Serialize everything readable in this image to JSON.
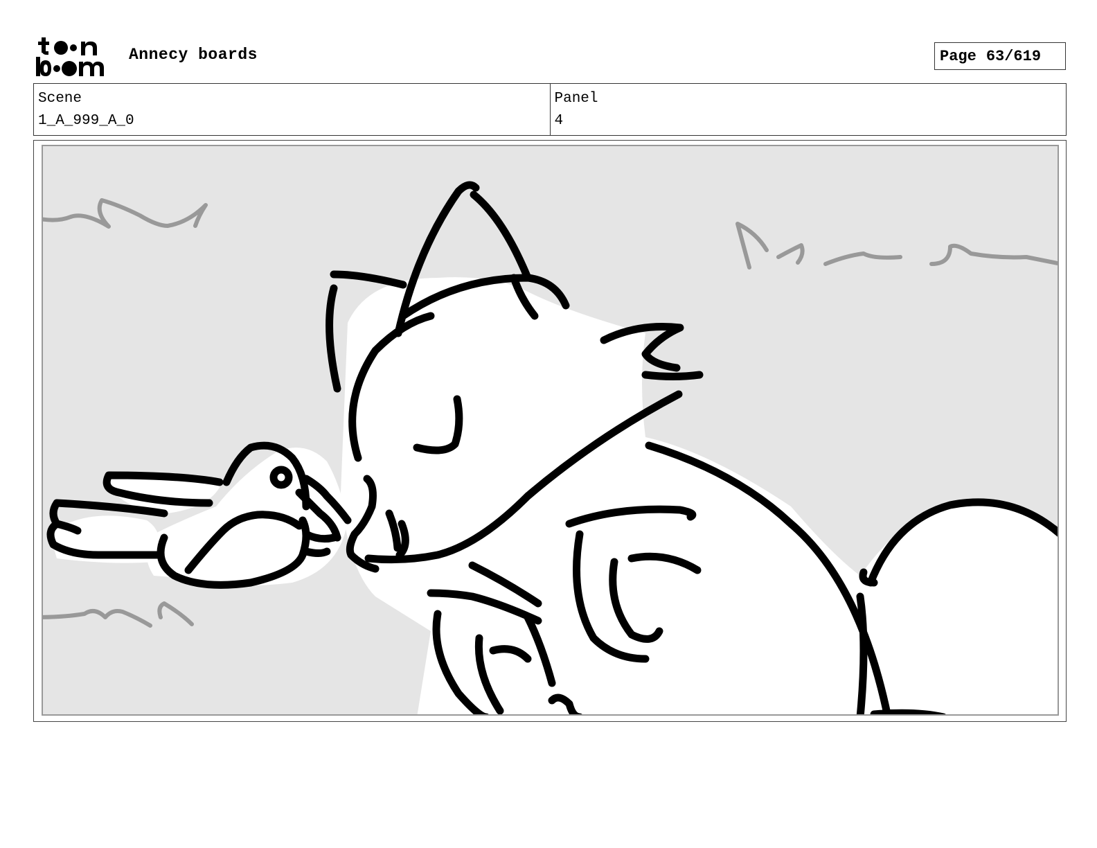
{
  "header": {
    "logo_name": "toon-boom-logo",
    "document_title": "Annecy boards",
    "page_label": "Page",
    "page_number": "63/619"
  },
  "info": {
    "scene_label": "Scene",
    "scene_value": "1_A_999_A_0",
    "panel_label": "Panel",
    "panel_value": "4"
  },
  "panel_image": {
    "subject": "storyboard sketch",
    "background_color": "#e5e5e5",
    "line_color": "#000000",
    "wind_color": "#999999"
  }
}
